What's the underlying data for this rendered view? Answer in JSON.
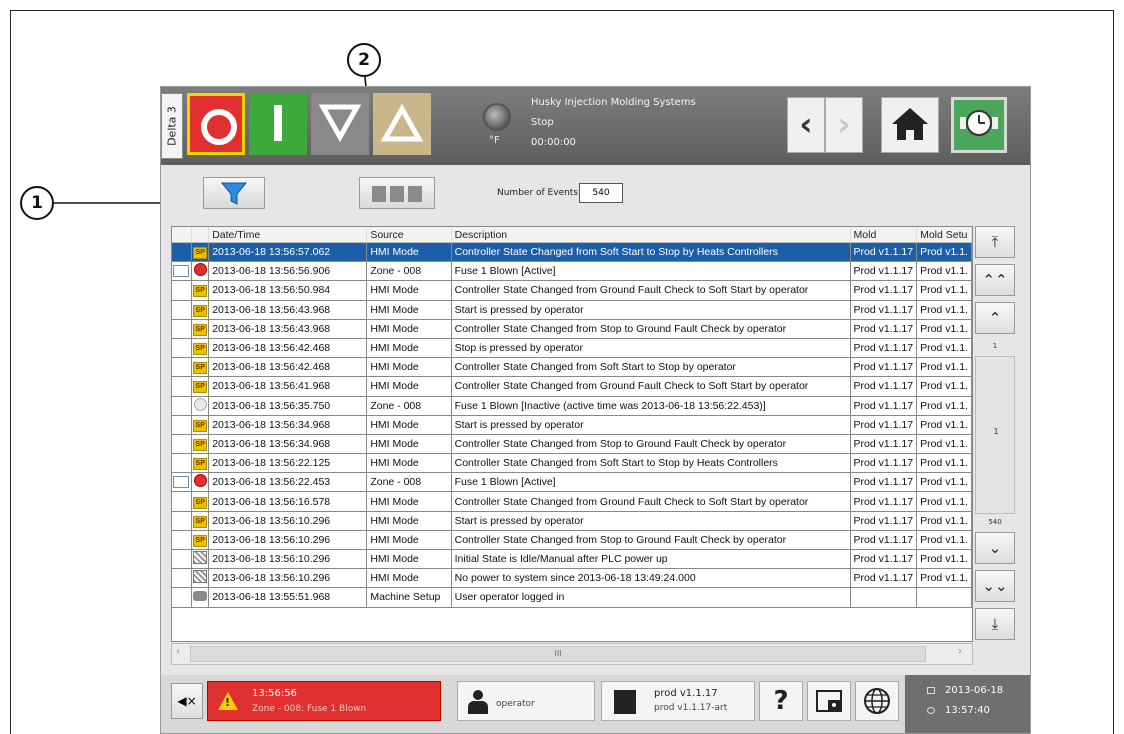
{
  "callouts": [
    "1",
    "2"
  ],
  "header": {
    "side_label": "Delta 3",
    "system_name": "Husky Injection Molding Systems",
    "state": "Stop",
    "cycle_time": "00:00:00",
    "temp_unit": "°F",
    "back_glyph": "‹",
    "forward_glyph": "›",
    "icons": {
      "stop": "stop-icon",
      "start": "start-icon",
      "down": "mode-down-icon",
      "up": "mode-up-icon",
      "home": "home-icon",
      "clock": "clock-icon"
    }
  },
  "toolbar": {
    "number_of_events_label": "Number of Events",
    "number_of_events": "540",
    "icons": {
      "filter": "filter-icon",
      "columns": "columns-icon"
    }
  },
  "table": {
    "columns": [
      "Date/Time",
      "Source",
      "Description",
      "Mold",
      "Mold Setu"
    ],
    "rows": [
      {
        "icon": "sp",
        "ack": false,
        "selected": true,
        "datetime": "2013-06-18 13:56:57.062",
        "source": "HMI Mode",
        "description": "Controller State Changed from Soft Start to Stop  by Heats Controllers",
        "mold": "Prod v1.1.17",
        "mold_setup": "Prod v1.1."
      },
      {
        "icon": "alarm",
        "ack": true,
        "selected": false,
        "datetime": "2013-06-18 13:56:56.906",
        "source": "Zone - 008",
        "description": "Fuse 1 Blown [Active]",
        "mold": "Prod v1.1.17",
        "mold_setup": "Prod v1.1."
      },
      {
        "icon": "sp",
        "ack": false,
        "selected": false,
        "datetime": "2013-06-18 13:56:50.984",
        "source": "HMI Mode",
        "description": "Controller State Changed from Ground Fault Check to Soft Start  by operator",
        "mold": "Prod v1.1.17",
        "mold_setup": "Prod v1.1."
      },
      {
        "icon": "sp",
        "ack": false,
        "selected": false,
        "datetime": "2013-06-18 13:56:43.968",
        "source": "HMI Mode",
        "description": "Start is pressed by operator",
        "mold": "Prod v1.1.17",
        "mold_setup": "Prod v1.1."
      },
      {
        "icon": "sp",
        "ack": false,
        "selected": false,
        "datetime": "2013-06-18 13:56:43.968",
        "source": "HMI Mode",
        "description": "Controller State Changed from Stop to Ground Fault Check  by operator",
        "mold": "Prod v1.1.17",
        "mold_setup": "Prod v1.1."
      },
      {
        "icon": "sp",
        "ack": false,
        "selected": false,
        "datetime": "2013-06-18 13:56:42.468",
        "source": "HMI Mode",
        "description": "Stop is pressed by operator",
        "mold": "Prod v1.1.17",
        "mold_setup": "Prod v1.1."
      },
      {
        "icon": "sp",
        "ack": false,
        "selected": false,
        "datetime": "2013-06-18 13:56:42.468",
        "source": "HMI Mode",
        "description": "Controller State Changed from Soft Start to Stop  by operator",
        "mold": "Prod v1.1.17",
        "mold_setup": "Prod v1.1."
      },
      {
        "icon": "sp",
        "ack": false,
        "selected": false,
        "datetime": "2013-06-18 13:56:41.968",
        "source": "HMI Mode",
        "description": "Controller State Changed from Ground Fault Check to Soft Start  by operator",
        "mold": "Prod v1.1.17",
        "mold_setup": "Prod v1.1."
      },
      {
        "icon": "inactive",
        "ack": false,
        "selected": false,
        "datetime": "2013-06-18 13:56:35.750",
        "source": "Zone - 008",
        "description": "Fuse 1 Blown [Inactive (active time was 2013-06-18 13:56:22.453)]",
        "mold": "Prod v1.1.17",
        "mold_setup": "Prod v1.1."
      },
      {
        "icon": "sp",
        "ack": false,
        "selected": false,
        "datetime": "2013-06-18 13:56:34.968",
        "source": "HMI Mode",
        "description": "Start is pressed by operator",
        "mold": "Prod v1.1.17",
        "mold_setup": "Prod v1.1."
      },
      {
        "icon": "sp",
        "ack": false,
        "selected": false,
        "datetime": "2013-06-18 13:56:34.968",
        "source": "HMI Mode",
        "description": "Controller State Changed from Stop to Ground Fault Check  by operator",
        "mold": "Prod v1.1.17",
        "mold_setup": "Prod v1.1."
      },
      {
        "icon": "sp",
        "ack": false,
        "selected": false,
        "datetime": "2013-06-18 13:56:22.125",
        "source": "HMI Mode",
        "description": "Controller State Changed from Soft Start to Stop  by Heats Controllers",
        "mold": "Prod v1.1.17",
        "mold_setup": "Prod v1.1."
      },
      {
        "icon": "alarm",
        "ack": true,
        "selected": false,
        "datetime": "2013-06-18 13:56:22.453",
        "source": "Zone - 008",
        "description": "Fuse 1 Blown [Active]",
        "mold": "Prod v1.1.17",
        "mold_setup": "Prod v1.1."
      },
      {
        "icon": "sp",
        "ack": false,
        "selected": false,
        "datetime": "2013-06-18 13:56:16.578",
        "source": "HMI Mode",
        "description": "Controller State Changed from Ground Fault Check to Soft Start  by operator",
        "mold": "Prod v1.1.17",
        "mold_setup": "Prod v1.1."
      },
      {
        "icon": "sp",
        "ack": false,
        "selected": false,
        "datetime": "2013-06-18 13:56:10.296",
        "source": "HMI Mode",
        "description": "Start is pressed by operator",
        "mold": "Prod v1.1.17",
        "mold_setup": "Prod v1.1."
      },
      {
        "icon": "sp",
        "ack": false,
        "selected": false,
        "datetime": "2013-06-18 13:56:10.296",
        "source": "HMI Mode",
        "description": "Controller State Changed from Stop to Ground Fault Check  by operator",
        "mold": "Prod v1.1.17",
        "mold_setup": "Prod v1.1."
      },
      {
        "icon": "state",
        "ack": false,
        "selected": false,
        "datetime": "2013-06-18 13:56:10.296",
        "source": "HMI Mode",
        "description": "Initial State is Idle/Manual after PLC power up",
        "mold": "Prod v1.1.17",
        "mold_setup": "Prod v1.1."
      },
      {
        "icon": "state",
        "ack": false,
        "selected": false,
        "datetime": "2013-06-18 13:56:10.296",
        "source": "HMI Mode",
        "description": "No power to system since 2013-06-18 13:49:24.000",
        "mold": "Prod v1.1.17",
        "mold_setup": "Prod v1.1."
      },
      {
        "icon": "login",
        "ack": false,
        "selected": false,
        "datetime": "2013-06-18 13:55:51.968",
        "source": "Machine Setup",
        "description": "User operator logged in",
        "mold": "",
        "mold_setup": ""
      }
    ],
    "icon_legend": {
      "sp": "SP",
      "alarm": "alarm-icon",
      "inactive": "inactive-alarm-icon",
      "state": "state-icon",
      "login": "login-icon"
    }
  },
  "scrollbar": {
    "buttons": [
      "⤒",
      "⌃⌃",
      "⌃",
      "⌄",
      "⌄⌄",
      "⤓"
    ],
    "top_index": "1",
    "current_page": "1",
    "bottom_index": "540",
    "horizontal_center": "III",
    "left_arrow": "‹",
    "right_arrow": "›"
  },
  "footer": {
    "mute_label": "◀×",
    "alarm_time": "13:56:56",
    "alarm_message": "Zone - 008: Fuse 1 Blown",
    "alarm_symbol": "!",
    "user": "operator",
    "mold_name": "prod v1.1.17",
    "mold_setup": "prod v1.1.17-art",
    "help": "?",
    "date": "2013-06-18",
    "time": "13:57:40"
  }
}
